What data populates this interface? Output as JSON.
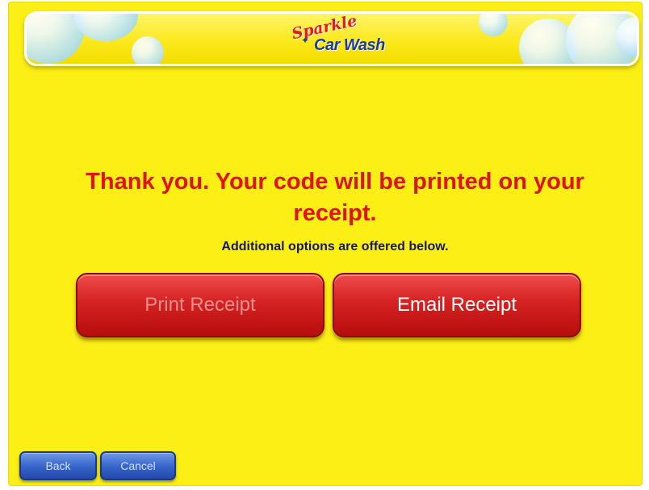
{
  "logo": {
    "script_text": "Sparkle",
    "main_text": "Car Wash"
  },
  "message": {
    "line1": "Thank you. Your code will be printed on your",
    "line2": "receipt."
  },
  "subtext": "Additional options are offered below.",
  "buttons": {
    "print_receipt": "Print Receipt",
    "email_receipt": "Email Receipt",
    "back": "Back",
    "cancel": "Cancel"
  },
  "colors": {
    "background": "#fbef16",
    "message_red": "#e01212",
    "button_red": "#d52222",
    "nav_blue": "#3463c9"
  },
  "states": {
    "print_receipt_disabled": true
  }
}
